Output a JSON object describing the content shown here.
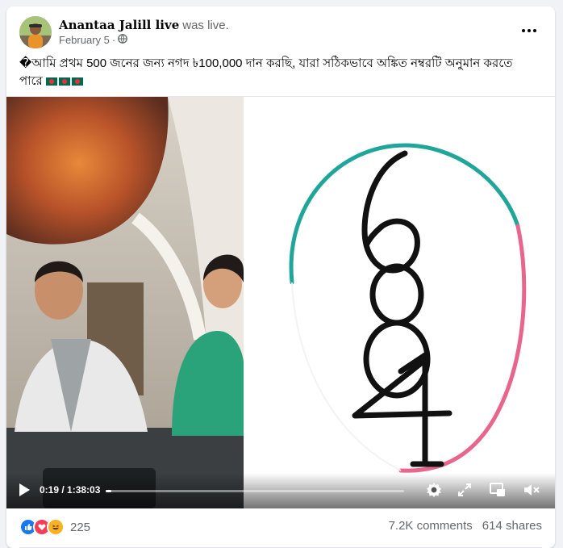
{
  "post": {
    "author": "Anantaa Jalill live",
    "status": "was live.",
    "date": "February 5",
    "date_separator": "·",
    "privacy_icon": "globe-icon",
    "more_icon": "more-horizontal-icon",
    "text": "�আমি প্রথম 500 জনের জন্য নগদ ৳100,000 দান করছি, যারা সঠিকভাবে অঙ্কিত নম্বরটি অনুমান করতে পারে",
    "flags": [
      "bangladesh-flag",
      "bangladesh-flag",
      "bangladesh-flag"
    ]
  },
  "video": {
    "drawn_digits": [
      "6",
      "8",
      "4",
      "1"
    ],
    "current_time": "0:19",
    "duration": "1:38:03",
    "time_display": "0:19 / 1:38:03",
    "progress_fraction": 0.0032,
    "icons": [
      "play-icon",
      "settings-icon",
      "fullscreen-icon",
      "picture-in-picture-icon",
      "volume-muted-icon"
    ]
  },
  "footer": {
    "reactions": [
      "like-icon",
      "love-icon",
      "haha-icon"
    ],
    "reaction_count": "225",
    "comments": "7.2K comments",
    "shares": "614 shares"
  },
  "colors": {
    "accent_blue": "#1877f2",
    "love_red": "#f33e58",
    "haha_yellow": "#f7b125",
    "secondary_text": "#65676b",
    "circle_teal": "#1fa59a",
    "circle_pink": "#e8668c"
  }
}
